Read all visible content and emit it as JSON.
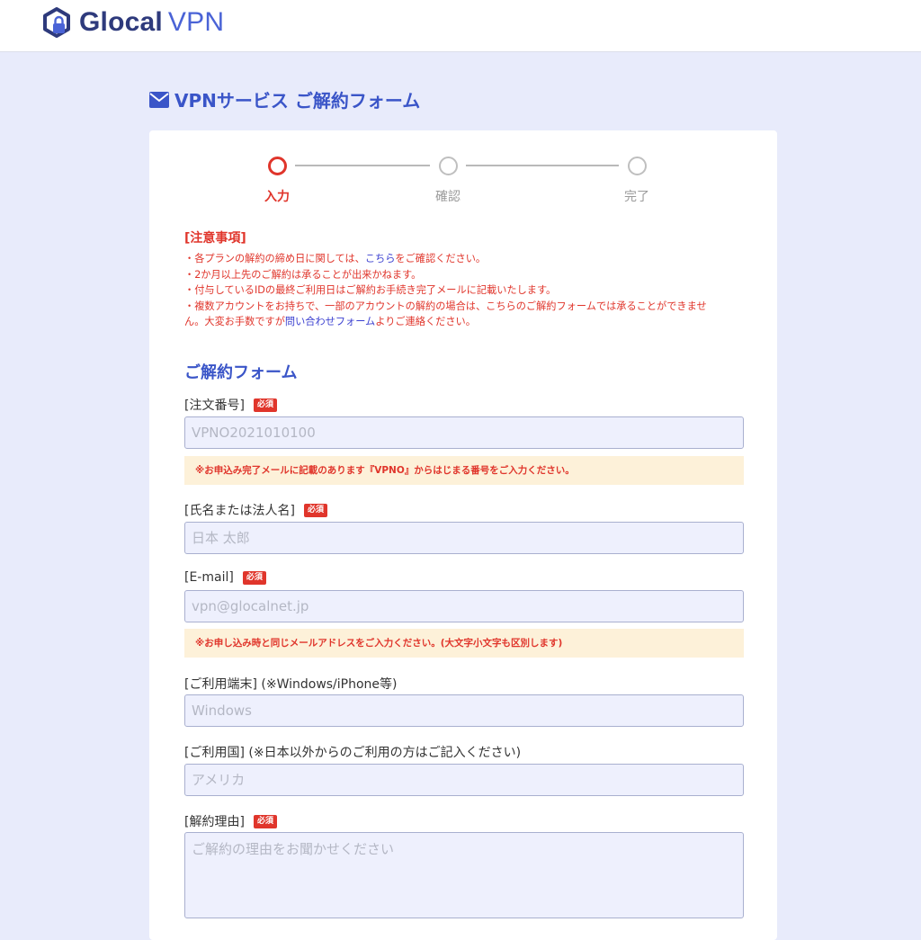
{
  "header": {
    "brand_name": "Glocal",
    "brand_suffix": "VPN"
  },
  "page": {
    "title": "VPNサービス ご解約フォーム"
  },
  "stepper": {
    "steps": [
      {
        "label": "入力",
        "state": "active"
      },
      {
        "label": "確認",
        "state": "inactive"
      },
      {
        "label": "完了",
        "state": "inactive"
      }
    ]
  },
  "notice": {
    "title": "[注意事項]",
    "item1_before": "・各プランの解約の締め日に関しては、",
    "item1_link": "こちら",
    "item1_after": "をご確認ください。",
    "item2": "・2か月以上先のご解約は承ることが出来かねます。",
    "item3": "・付与しているIDの最終ご利用日はご解約お手続き完了メールに記載いたします。",
    "item4_line1": "・複数アカウントをお持ちで、一部のアカウントの解約の場合は、こちらのご解約フォームでは承ることができませ",
    "item4_line2_before": "ん。大変お手数ですが",
    "item4_link": "問い合わせフォーム",
    "item4_line2_after": "よりご連絡ください。"
  },
  "form": {
    "section_title": "ご解約フォーム",
    "required_badge": "必須",
    "order_number": {
      "label": "[注文番号]",
      "placeholder": "VPNO2021010100",
      "value": "",
      "hint": "※お申込み完了メールに記載のあります『VPNO』からはじまる番号をご入力ください。"
    },
    "name": {
      "label": "[氏名または法人名]",
      "placeholder": "日本 太郎",
      "value": ""
    },
    "email": {
      "label": "[E-mail]",
      "placeholder": "vpn@glocalnet.jp",
      "value": "",
      "hint": "※お申し込み時と同じメールアドレスをご入力ください。(大文字小文字も区別します)"
    },
    "device": {
      "label": "[ご利用端末] (※Windows/iPhone等)",
      "placeholder": "Windows",
      "value": ""
    },
    "country": {
      "label": "[ご利用国] (※日本以外からのご利用の方はご記入ください)",
      "placeholder": "アメリカ",
      "value": ""
    },
    "reason": {
      "label": "[解約理由]",
      "placeholder": "ご解約の理由をお聞かせください",
      "value": ""
    }
  },
  "colors": {
    "accent_blue": "#3a55c8",
    "alert_red": "#e0352b",
    "page_bg": "#e8ebfb",
    "hint_bg": "#fdf1d9",
    "input_bg": "#eef0fd"
  }
}
